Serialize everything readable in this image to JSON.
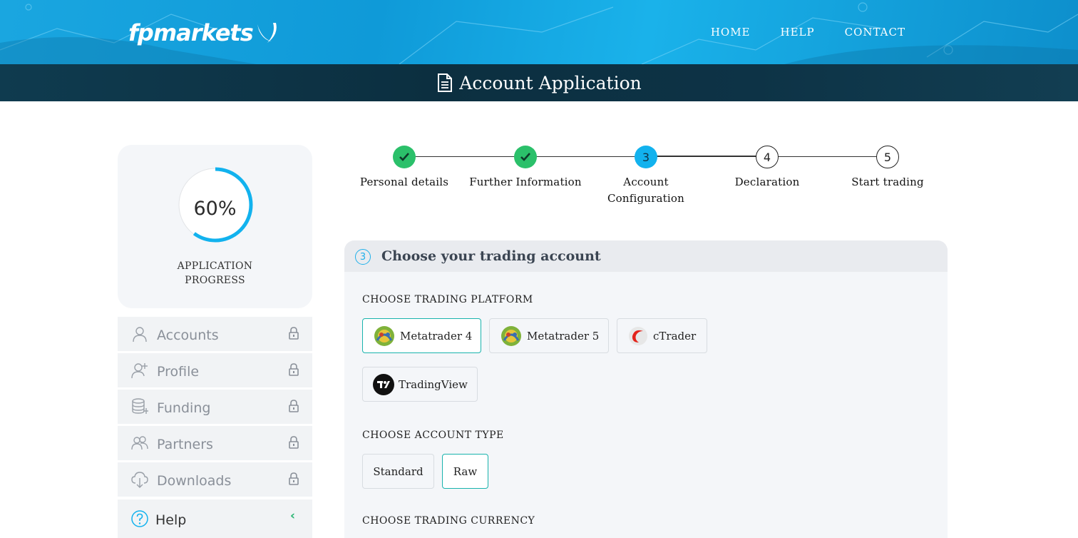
{
  "header": {
    "logo_text": "fpmarkets",
    "nav": [
      "HOME",
      "HELP",
      "CONTACT"
    ]
  },
  "titlebar": {
    "title": "Account Application"
  },
  "progress": {
    "percent": 60,
    "percent_label": "60%",
    "caption_line1": "APPLICATION",
    "caption_line2": "PROGRESS"
  },
  "sidebar": {
    "items": [
      {
        "label": "Accounts",
        "icon": "user-icon",
        "locked": true
      },
      {
        "label": "Profile",
        "icon": "user-plus-icon",
        "locked": true
      },
      {
        "label": "Funding",
        "icon": "coins-icon",
        "locked": true
      },
      {
        "label": "Partners",
        "icon": "users-icon",
        "locked": true
      },
      {
        "label": "Downloads",
        "icon": "cloud-download-icon",
        "locked": true
      },
      {
        "label": "Help",
        "icon": "help-icon",
        "expand": "‹"
      }
    ]
  },
  "steps": [
    {
      "label_line1": "Personal details",
      "label_line2": "",
      "state": "done"
    },
    {
      "label_line1": "Further Information",
      "label_line2": "",
      "state": "done"
    },
    {
      "label_line1": "Account",
      "label_line2": "Configuration",
      "state": "active",
      "number": "3"
    },
    {
      "label_line1": "Declaration",
      "label_line2": "",
      "state": "todo",
      "number": "4"
    },
    {
      "label_line1": "Start trading",
      "label_line2": "",
      "state": "todo",
      "number": "5"
    }
  ],
  "panel": {
    "step_number": "3",
    "title": "Choose your trading account",
    "platform_label": "CHOOSE TRADING PLATFORM",
    "platforms": [
      {
        "label": "Metatrader 4",
        "selected": true
      },
      {
        "label": "Metatrader 5",
        "selected": false
      },
      {
        "label": "cTrader",
        "selected": false
      },
      {
        "label": "TradingView",
        "selected": false
      }
    ],
    "account_type_label": "CHOOSE ACCOUNT TYPE",
    "account_types": [
      {
        "label": "Standard",
        "selected": false
      },
      {
        "label": "Raw",
        "selected": true
      }
    ],
    "currency_label": "CHOOSE TRADING CURRENCY"
  },
  "colors": {
    "brand_blue": "#12b2ee",
    "success_green": "#2bc06a",
    "selected_teal": "#19b3ad",
    "title_dark": "#0c2f40"
  }
}
